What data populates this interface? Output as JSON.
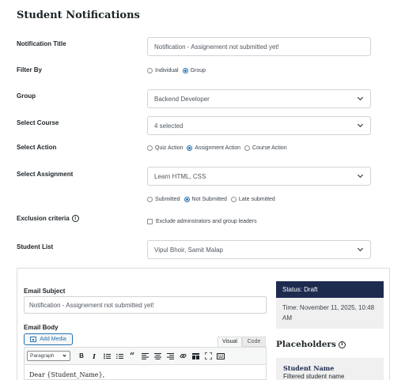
{
  "page": {
    "title": "Student Notifications"
  },
  "form": {
    "notification_title": {
      "label": "Notification Title",
      "value": "Notification - Assignement not submitted yet!"
    },
    "filter_by": {
      "label": "Filter By",
      "options": [
        "Individual",
        "Group"
      ],
      "selected": "Group"
    },
    "group": {
      "label": "Group",
      "value": "Backend Developer"
    },
    "select_course": {
      "label": "Select Course",
      "value": "4 selected"
    },
    "select_action": {
      "label": "Select Action",
      "options": [
        "Quiz Action",
        "Assignment Action",
        "Course Action"
      ],
      "selected": "Assignment Action"
    },
    "select_assignment": {
      "label": "Select Assignment",
      "value": "Learn HTML, CSS"
    },
    "submission_status": {
      "options": [
        "Submitted",
        "Not Submitted",
        "Late submitted"
      ],
      "selected": "Not Submitted"
    },
    "exclusion": {
      "label": "Exclusion criteria",
      "checkbox_label": "Exclude adminstrators and group leaders",
      "checked": false
    },
    "student_list": {
      "label": "Student List",
      "value": "Vipul Bhoir, Samit Malap"
    }
  },
  "email": {
    "subject_label": "Email Subject",
    "subject_value": "Notification - Assignement not submitted yet!",
    "body_label": "Email Body",
    "add_media_label": "Add Media",
    "tabs": [
      "Visual",
      "Code"
    ],
    "active_tab": "Visual",
    "format_select": "Paragraph",
    "toolbar_icons": [
      "bold-icon",
      "italic-icon",
      "bullet-list-icon",
      "numbered-list-icon",
      "blockquote-icon",
      "align-left-icon",
      "align-center-icon",
      "align-right-icon",
      "link-icon",
      "toolbar-toggle-icon",
      "fullscreen-icon",
      "kitchen-sink-icon"
    ],
    "body_text": "Dear {Student_Name},"
  },
  "status": {
    "label": "Status: Draft",
    "time": "Time: November 11, 2025, 10:48 AM"
  },
  "placeholders": {
    "title": "Placeholders",
    "items": [
      {
        "name": "Student Name",
        "desc": "Filtered student name"
      }
    ]
  },
  "colors": {
    "accent": "#2271b1",
    "status_header": "#1d2b4f"
  }
}
